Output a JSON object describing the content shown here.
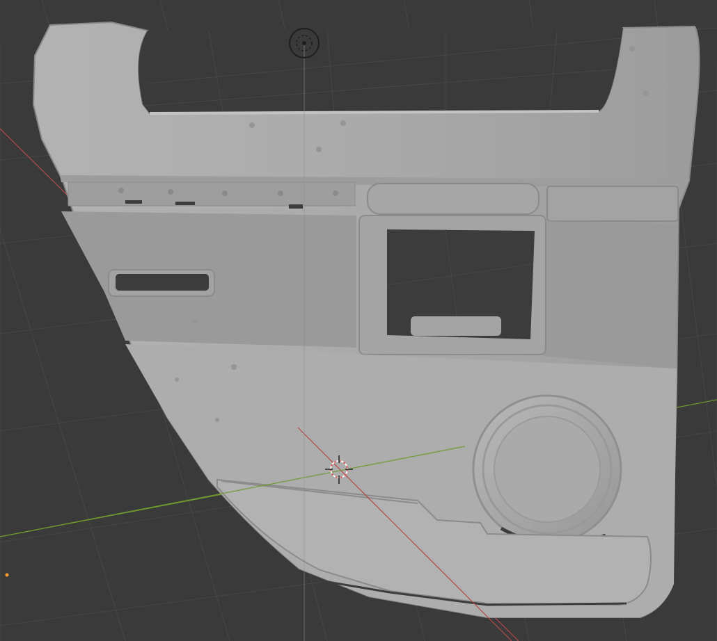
{
  "viewport": {
    "background": "#3a3a3a",
    "grid_color": "#474747",
    "x_axis_color": "#b34a4e",
    "y_axis_color": "#6f9a2f",
    "mesh_color": "#a9a9a9",
    "mesh_shadow": "#8e8e8e",
    "hole_color": "#3c3c3c",
    "cursor_color": "#e05a5a",
    "origin_color": "#ff9a2e"
  },
  "scene": {
    "object": "scanned-door-panel-mesh",
    "shading": "solid"
  }
}
